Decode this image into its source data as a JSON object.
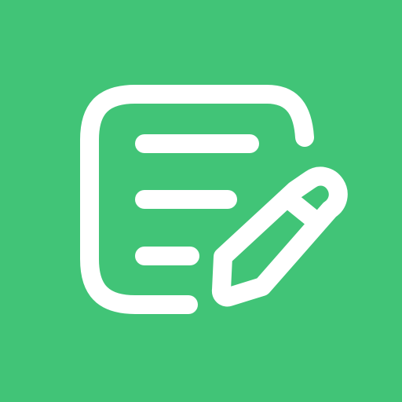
{
  "icon": {
    "semantic": "notes-edit-icon",
    "background_color": "#41C477",
    "foreground_color": "#FFFFFF",
    "parts": [
      "document-outline",
      "text-lines",
      "pencil"
    ]
  }
}
